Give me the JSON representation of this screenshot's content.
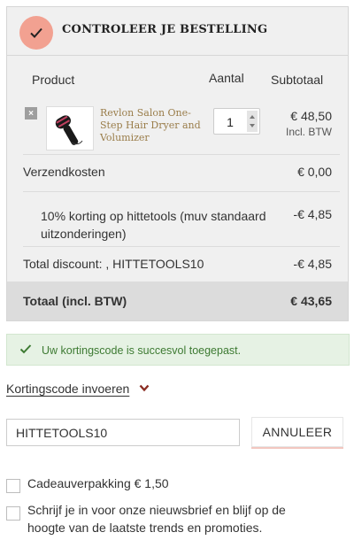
{
  "order": {
    "title": "CONTROLEER JE BESTELLING",
    "columns": {
      "product": "Product",
      "quantity": "Aantal",
      "subtotal": "Subtotaal"
    },
    "item": {
      "remove_glyph": "×",
      "name": "Revlon Salon One-Step Hair Dryer and Volumizer",
      "quantity": "1",
      "price": "€ 48,50",
      "price_note": "Incl. BTW"
    },
    "shipping": {
      "label": "Verzendkosten",
      "value": "€ 0,00"
    },
    "discount_line": {
      "label": "10% korting op hittetools (muv standaard uitzonderingen)",
      "value": "-€ 4,85"
    },
    "total_discount": {
      "label": "Total discount: , HITTETOOLS10",
      "value": "-€ 4,85"
    },
    "total": {
      "label": "Totaal (incl. BTW)",
      "value": "€ 43,65"
    }
  },
  "success": {
    "message": "Uw kortingscode is succesvol toegepast."
  },
  "coupon": {
    "toggle_label": "Kortingscode invoeren",
    "input_value": "HITTETOOLS10",
    "cancel_label": "ANNULEER"
  },
  "options": {
    "gift_wrap": "Cadeauverpakking € 1,50",
    "newsletter": "Schrijf je in voor onze nieuwsbrief en blijf op de hoogte van de laatste trends en promoties."
  },
  "colors": {
    "accent_circle": "#f2a191",
    "product_link": "#9a7d4a",
    "success_text": "#3d7a32",
    "success_bg": "#e6f2e4",
    "chevron": "#8b2d23"
  },
  "icons": {
    "header": "checkmark-icon",
    "success": "checkmark-icon",
    "toggle": "chevron-down-icon"
  }
}
